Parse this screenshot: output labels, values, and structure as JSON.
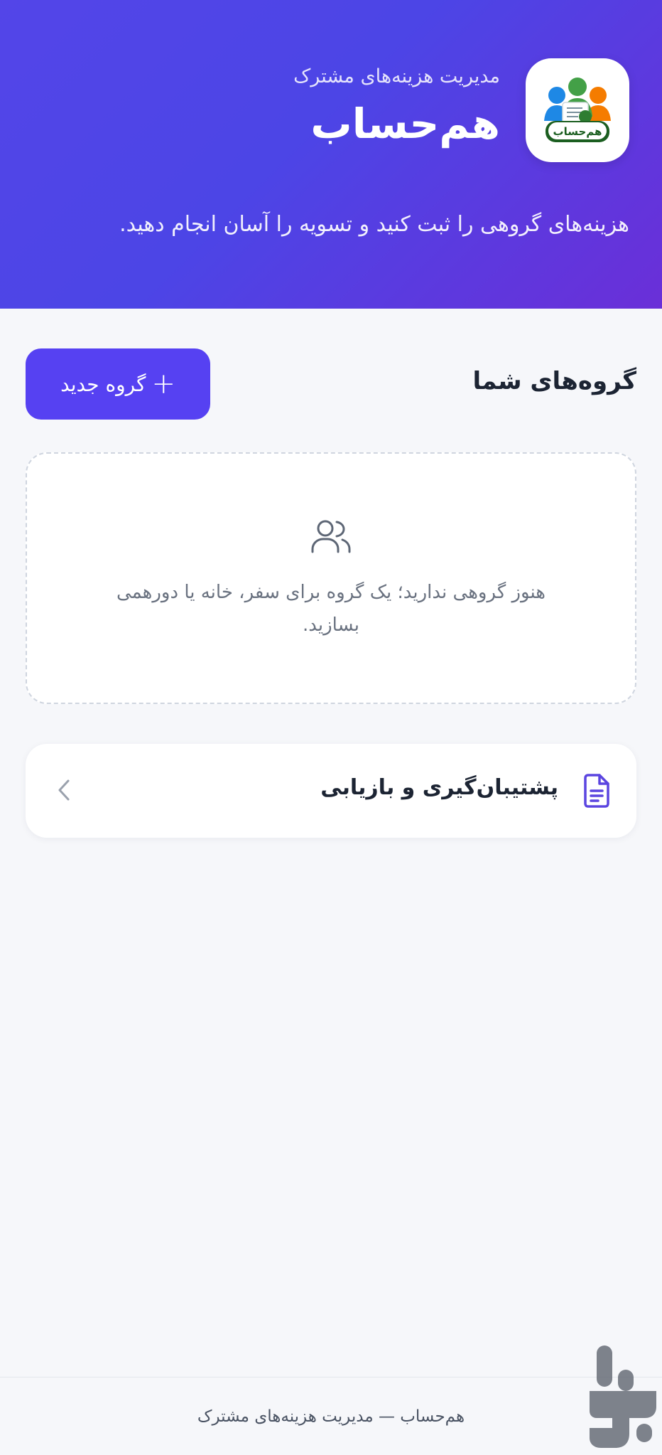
{
  "header": {
    "subtitle": "مدیریت هزینه‌های مشترک",
    "title": "هم‌حساب",
    "tagline": "هزینه‌های گروهی را ثبت کنید و تسویه را آسان انجام دهید.",
    "logo_text": "هم‌حساب"
  },
  "groups": {
    "section_title": "گروه‌های شما",
    "new_group_label": "گروه جدید",
    "empty_message": "هنوز گروهی ندارید؛ یک گروه برای سفر، خانه یا دورهمی بسازید."
  },
  "backup": {
    "label": "پشتیبان‌گیری و بازیابی"
  },
  "footer": {
    "text": "هم‌حساب — مدیریت هزینه‌های مشترک"
  },
  "icons": {
    "plus": "plus-icon",
    "users": "users-icon",
    "document": "document-icon",
    "chevron": "chevron-left-icon",
    "logo": "app-logo-icon",
    "watermark": "store-watermark-icon"
  },
  "colors": {
    "hero_gradient_start": "#5345e8",
    "hero_gradient_end": "#6a2fd8",
    "primary_button": "#5641f2",
    "icon_accent": "#5b45e0",
    "background": "#f6f7fa"
  }
}
